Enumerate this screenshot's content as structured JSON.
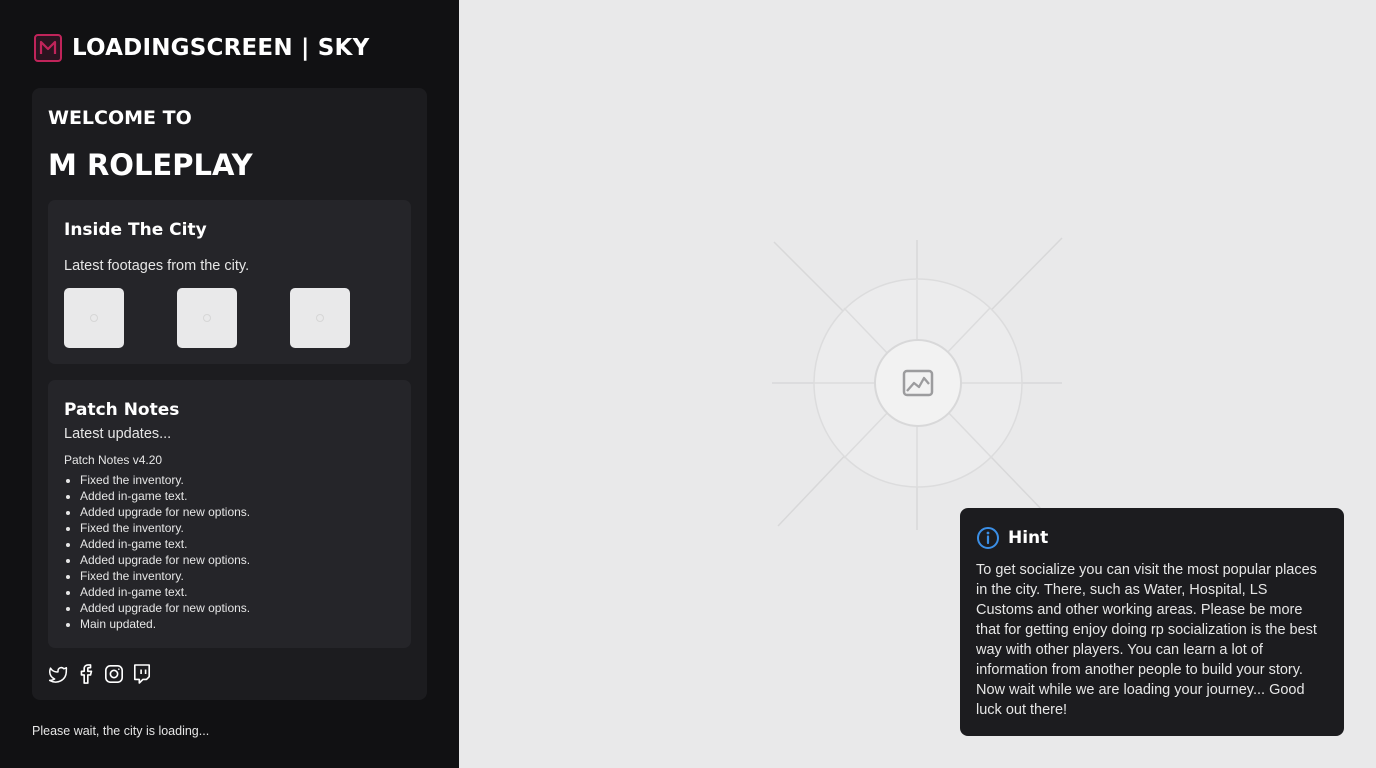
{
  "brand": {
    "logo_letter": "M",
    "title": "LOADINGSCREEN | SKY",
    "accent_color": "#c0245a"
  },
  "welcome": {
    "heading": "WELCOME TO",
    "server_name": "M ROLEPLAY"
  },
  "city": {
    "title": "Inside The City",
    "description": "Latest footages from the city.",
    "thumbnails": [
      "image-placeholder-icon",
      "image-placeholder-icon",
      "image-placeholder-icon"
    ]
  },
  "patch_notes": {
    "title": "Patch Notes",
    "description": "Latest updates...",
    "version": "Patch Notes v4.20",
    "items": [
      "Fixed the inventory.",
      "Added in-game text.",
      "Added upgrade for new options.",
      "Fixed the inventory.",
      "Added in-game text.",
      "Added upgrade for new options.",
      "Fixed the inventory.",
      "Added in-game text.",
      "Added upgrade for new options.",
      "Main updated."
    ]
  },
  "socials": [
    "twitter-icon",
    "facebook-icon",
    "instagram-icon",
    "twitch-icon"
  ],
  "status": {
    "loading_text": "Please wait, the city is loading..."
  },
  "hint": {
    "title": "Hint",
    "icon": "info-icon",
    "icon_color": "#3b8fe6",
    "text": "To get socialize you can visit the most popular places in the city. There, such as Water, Hospital, LS Customs and other working areas. Please be more that for getting enjoy doing rp socialization is the best way with other players. You can learn a lot of information from another people to build your story. Now wait while we are loading your journey... Good luck out there!"
  },
  "background": {
    "icon": "image-placeholder-icon"
  }
}
